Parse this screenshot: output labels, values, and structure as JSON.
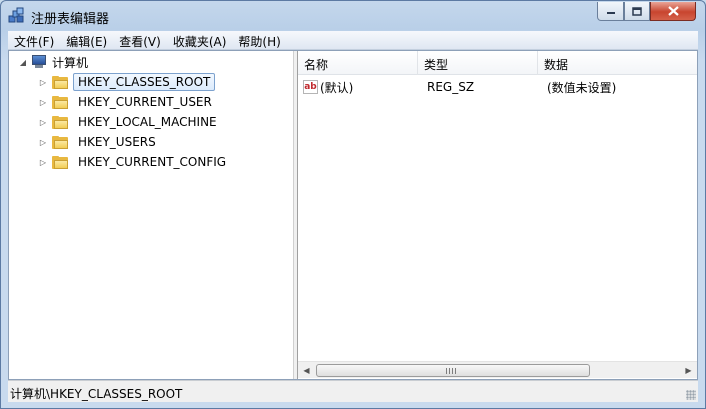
{
  "window": {
    "title": "注册表编辑器"
  },
  "controls": {
    "minimize": "minimize-icon",
    "maximize": "maximize-icon",
    "close": "close-icon"
  },
  "menu": [
    "文件(F)",
    "编辑(E)",
    "查看(V)",
    "收藏夹(A)",
    "帮助(H)"
  ],
  "tree": {
    "root": "计算机",
    "keys": [
      "HKEY_CLASSES_ROOT",
      "HKEY_CURRENT_USER",
      "HKEY_LOCAL_MACHINE",
      "HKEY_USERS",
      "HKEY_CURRENT_CONFIG"
    ],
    "selected": "HKEY_CLASSES_ROOT"
  },
  "list": {
    "columns": [
      "名称",
      "类型",
      "数据"
    ],
    "rows": [
      {
        "name": "(默认)",
        "type": "REG_SZ",
        "data": "(数值未设置)",
        "icon": "ab"
      }
    ]
  },
  "status": {
    "path": "计算机\\HKEY_CLASSES_ROOT"
  }
}
